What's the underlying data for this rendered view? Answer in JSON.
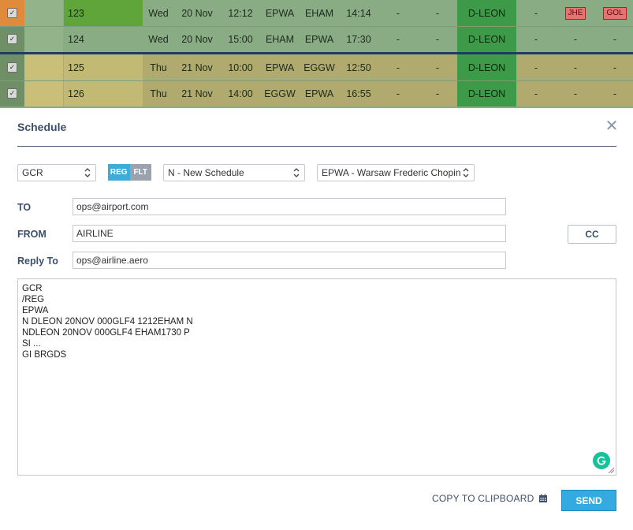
{
  "flights": [
    {
      "no": "123",
      "day": "Wed",
      "date": "20 Nov",
      "std": "12:12",
      "dep": "EPWA",
      "arr": "EHAM",
      "sta": "14:14",
      "d1": "-",
      "d2": "-",
      "reg": "D-LEON",
      "d3": "-",
      "tag1": "JHE",
      "tag2": "GOL"
    },
    {
      "no": "124",
      "day": "Wed",
      "date": "20 Nov",
      "std": "15:00",
      "dep": "EHAM",
      "arr": "EPWA",
      "sta": "17:30",
      "d1": "-",
      "d2": "-",
      "reg": "D-LEON",
      "d3": "-",
      "tag1": "-",
      "tag2": "-"
    },
    {
      "no": "125",
      "day": "Thu",
      "date": "21 Nov",
      "std": "10:00",
      "dep": "EPWA",
      "arr": "EGGW",
      "sta": "12:50",
      "d1": "-",
      "d2": "-",
      "reg": "D-LEON",
      "d3": "-",
      "tag1": "-",
      "tag2": "-"
    },
    {
      "no": "126",
      "day": "Thu",
      "date": "21 Nov",
      "std": "14:00",
      "dep": "EGGW",
      "arr": "EPWA",
      "sta": "16:55",
      "d1": "-",
      "d2": "-",
      "reg": "D-LEON",
      "d3": "-",
      "tag1": "-",
      "tag2": "-"
    }
  ],
  "colors": {
    "row_a": "#8aac84",
    "row_b": "#b0aa6f",
    "no_cell_a": "#5fa53a",
    "no_cell_b": "#c2b974",
    "reg_cell": "#3c9a48",
    "accent": "#33aae0"
  },
  "modal": {
    "title": "Schedule",
    "close_icon": "close-icon",
    "message_type": "GCR",
    "toggle": {
      "reg": "REG",
      "flt": "FLT",
      "active": "REG"
    },
    "schedule_type": "N - New Schedule",
    "airport": "EPWA - Warsaw Frederic Chopin",
    "to_label": "TO",
    "to_value": "ops@airport.com",
    "from_label": "FROM",
    "from_value": "AIRLINE",
    "reply_label": "Reply To",
    "reply_value": "ops@airline.aero",
    "cc_label": "CC",
    "message_lines": [
      "GCR",
      "/REG",
      "EPWA",
      "N DLEON 20NOV 000GLF4 1212EHAM N",
      "NDLEON 20NOV 000GLF4 EHAM1730 P",
      "SI ...",
      "GI BRGDS"
    ],
    "copy_label": "COPY TO CLIPBOARD",
    "copy_icon": "clipboard-icon",
    "send_label": "SEND"
  }
}
